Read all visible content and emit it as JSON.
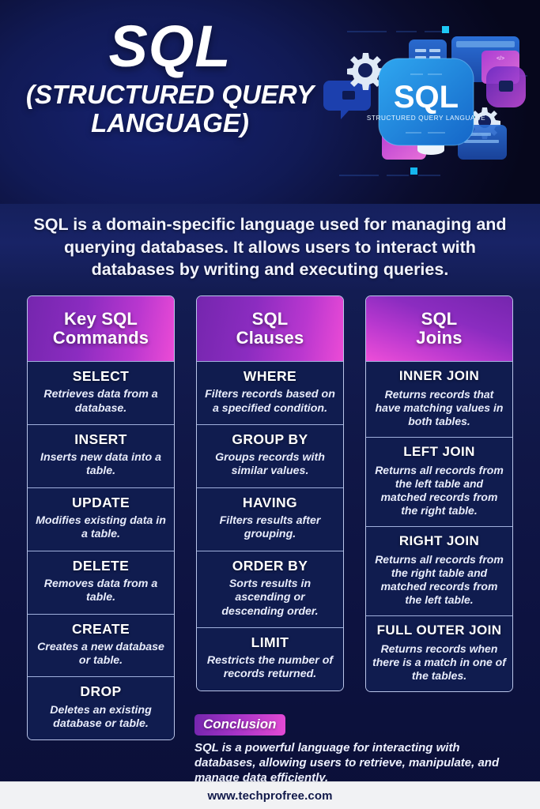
{
  "header": {
    "title": "SQL",
    "subtitle": "(STRUCTURED QUERY LANGUAGE)",
    "illustration": {
      "card_title": "SQL",
      "card_subtitle": "STRUCTURED QUERY LANGUAGE",
      "code_tag": "</>"
    }
  },
  "intro": {
    "text": "SQL is a domain-specific language used for managing and querying databases. It allows users to interact with databases by writing and executing queries."
  },
  "colors": {
    "background_dark": "#0b1038",
    "header_band": "#07091f",
    "card_fill": "#101c4f",
    "card_border": "#b9c4e8",
    "gradient_purple": "#7526ae",
    "gradient_pink": "#ec4bd6",
    "footer_background": "#f1f2f4",
    "footer_text": "#11194a"
  },
  "columns": [
    {
      "heading": "Key SQL\nCommands",
      "heading_line1": "Key SQL",
      "heading_line2": "Commands",
      "items": [
        {
          "title": "SELECT",
          "desc": "Retrieves data from a database."
        },
        {
          "title": "INSERT",
          "desc": "Inserts new data into a table."
        },
        {
          "title": "UPDATE",
          "desc": "Modifies existing data in a table."
        },
        {
          "title": "DELETE",
          "desc": "Removes data from a table."
        },
        {
          "title": "CREATE",
          "desc": "Creates a new database or table."
        },
        {
          "title": "DROP",
          "desc": "Deletes an existing database or table."
        }
      ]
    },
    {
      "heading": "SQL\nClauses",
      "heading_line1": "SQL",
      "heading_line2": "Clauses",
      "items": [
        {
          "title": "WHERE",
          "desc": "Filters records based on a specified condition."
        },
        {
          "title": "GROUP BY",
          "desc": "Groups records with similar values."
        },
        {
          "title": "HAVING",
          "desc": "Filters results after grouping."
        },
        {
          "title": "ORDER BY",
          "desc": "Sorts results in ascending or descending order."
        },
        {
          "title": "LIMIT",
          "desc": "Restricts the number of records returned."
        }
      ]
    },
    {
      "heading": "SQL\nJoins",
      "heading_line1": "SQL",
      "heading_line2": "Joins",
      "items": [
        {
          "title": "INNER JOIN",
          "desc": "Returns records that have matching values in both tables."
        },
        {
          "title": "LEFT JOIN",
          "desc": "Returns all records from the left table and matched records from the right table."
        },
        {
          "title": "RIGHT JOIN",
          "desc": "Returns all records from the right table and matched records from the left table."
        },
        {
          "title": "FULL OUTER JOIN",
          "desc": "Returns records when there is a match in one of the tables."
        }
      ]
    }
  ],
  "conclusion": {
    "badge": "Conclusion",
    "text": "SQL is a powerful language for interacting with databases, allowing users to retrieve, manipulate, and manage data efficiently."
  },
  "footer": {
    "url": "www.techprofree.com"
  }
}
